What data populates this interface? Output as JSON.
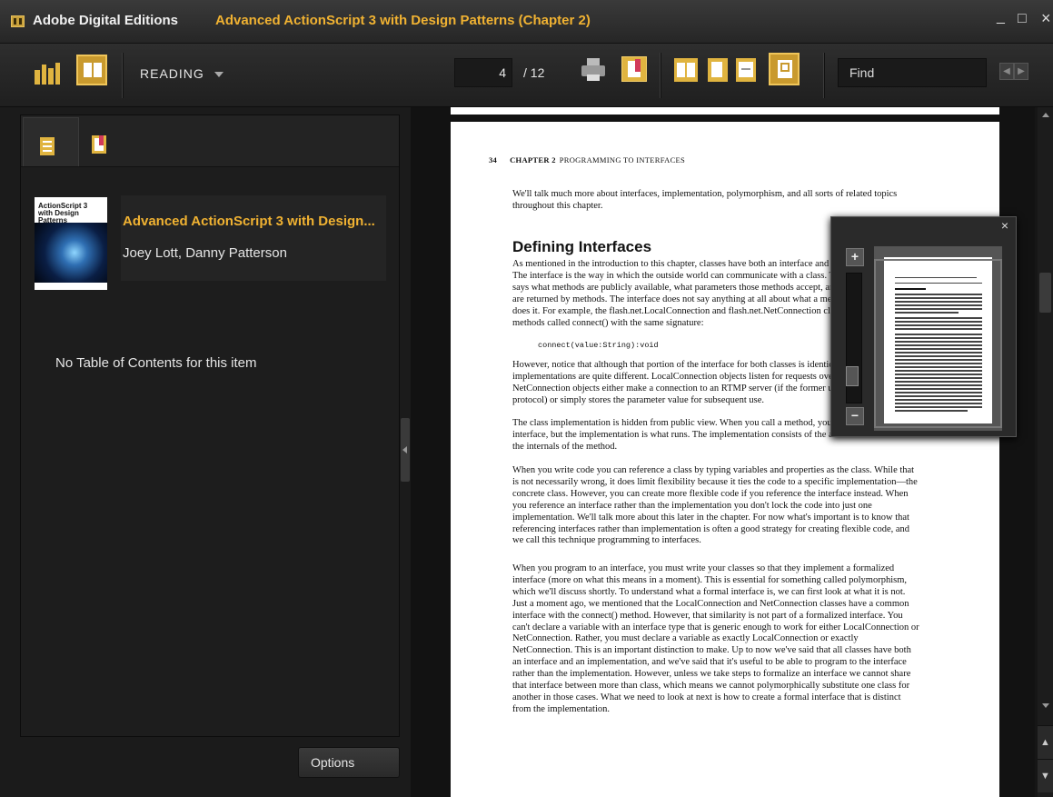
{
  "window": {
    "app_name": "Adobe Digital Editions",
    "document_title": "Advanced ActionScript 3 with Design Patterns (Chapter 2)",
    "minimize": "_",
    "maximize": "□",
    "close": "×"
  },
  "toolbar": {
    "mode_label": "READING",
    "page_current": "4",
    "page_total": "/ 12",
    "find_placeholder": "Find",
    "icons": [
      "library-view-icon",
      "reading-view-icon",
      "print-icon",
      "bookmark-icon",
      "single-page-icon",
      "fit-page-icon",
      "fit-width-icon",
      "two-page-icon"
    ]
  },
  "sidebar": {
    "tabs": [
      "table-of-contents-icon",
      "bookmarks-icon"
    ],
    "book": {
      "cover_title": "ActionScript 3 with Design Patterns",
      "title": "Advanced ActionScript 3 with Design...",
      "author": "Joey Lott, Danny Patterson"
    },
    "toc_message": "No Table of Contents for this item",
    "options_label": "Options"
  },
  "page": {
    "running_head_num": "34",
    "running_head_chapter": "CHAPTER 2",
    "running_head_title": "PROGRAMMING TO INTERFACES",
    "intro": "We'll talk much more about interfaces, implementation, polymorphism, and all sorts of related topics throughout this chapter.",
    "heading": "Defining Interfaces",
    "p1": "As mentioned in the introduction to this chapter, classes have both an interface and an implementation. The interface is the way in which the outside world can communicate with a class. The interface simply says what methods are publicly available, what parameters those methods accept, and what, if any, types are returned by methods. The interface does not say anything at all about what a method does or how it does it. For example, the flash.net.LocalConnection and flash.net.NetConnection classes both define methods called connect() with the same signature:",
    "code": "connect(value:String):void",
    "p2": "However, notice that although that portion of the interface for both classes is identical, the implementations are quite different. LocalConnection objects listen for requests over a local channel while NetConnection objects either make a connection to an RTMP server (if the former uses the RTMP protocol) or simply stores the parameter value for subsequent use.",
    "p3": "The class implementation is hidden from public view. When you call a method, you call it by way of the interface, but the implementation is what runs. The implementation consists of the actual code that defines the internals of the method.",
    "p4": "When you write code you can reference a class by typing variables and properties as the class. While that is not necessarily wrong, it does limit flexibility because it ties the code to a specific implementation—the concrete class. However, you can create more flexible code if you reference the interface instead. When you reference an interface rather than the implementation you don't lock the code into just one implementation. We'll talk more about this later in the chapter. For now what's important is to know that referencing interfaces rather than implementation is often a good strategy for creating flexible code, and we call this technique programming to interfaces.",
    "p5": "When you program to an interface, you must write your classes so that they implement a formalized interface (more on what this means in a moment). This is essential for something called polymorphism, which we'll discuss shortly. To understand what a formal interface is, we can first look at what it is not. Just a moment ago, we mentioned that the LocalConnection and NetConnection classes have a common interface with the connect() method. However, that similarity is not part of a formalized interface. You can't declare a variable with an interface type that is generic enough to work for either LocalConnection or NetConnection. Rather, you must declare a variable as exactly LocalConnection or exactly NetConnection. This is an important distinction to make. Up to now we've said that all classes have both an interface and an implementation, and we've said that it's useful to be able to program to the interface rather than the implementation. However, unless we take steps to formalize an interface we cannot share that interface between more than class, which means we cannot polymorphically substitute one class for another in those cases. What we need to look at next is how to create a formal interface that is distinct from the implementation."
  },
  "zoom_window": {
    "close": "×",
    "plus": "+",
    "minus": "−",
    "preview_heading": "Defining Interfaces"
  },
  "scroll": {
    "page_up": "▲",
    "page_down": "▼"
  }
}
